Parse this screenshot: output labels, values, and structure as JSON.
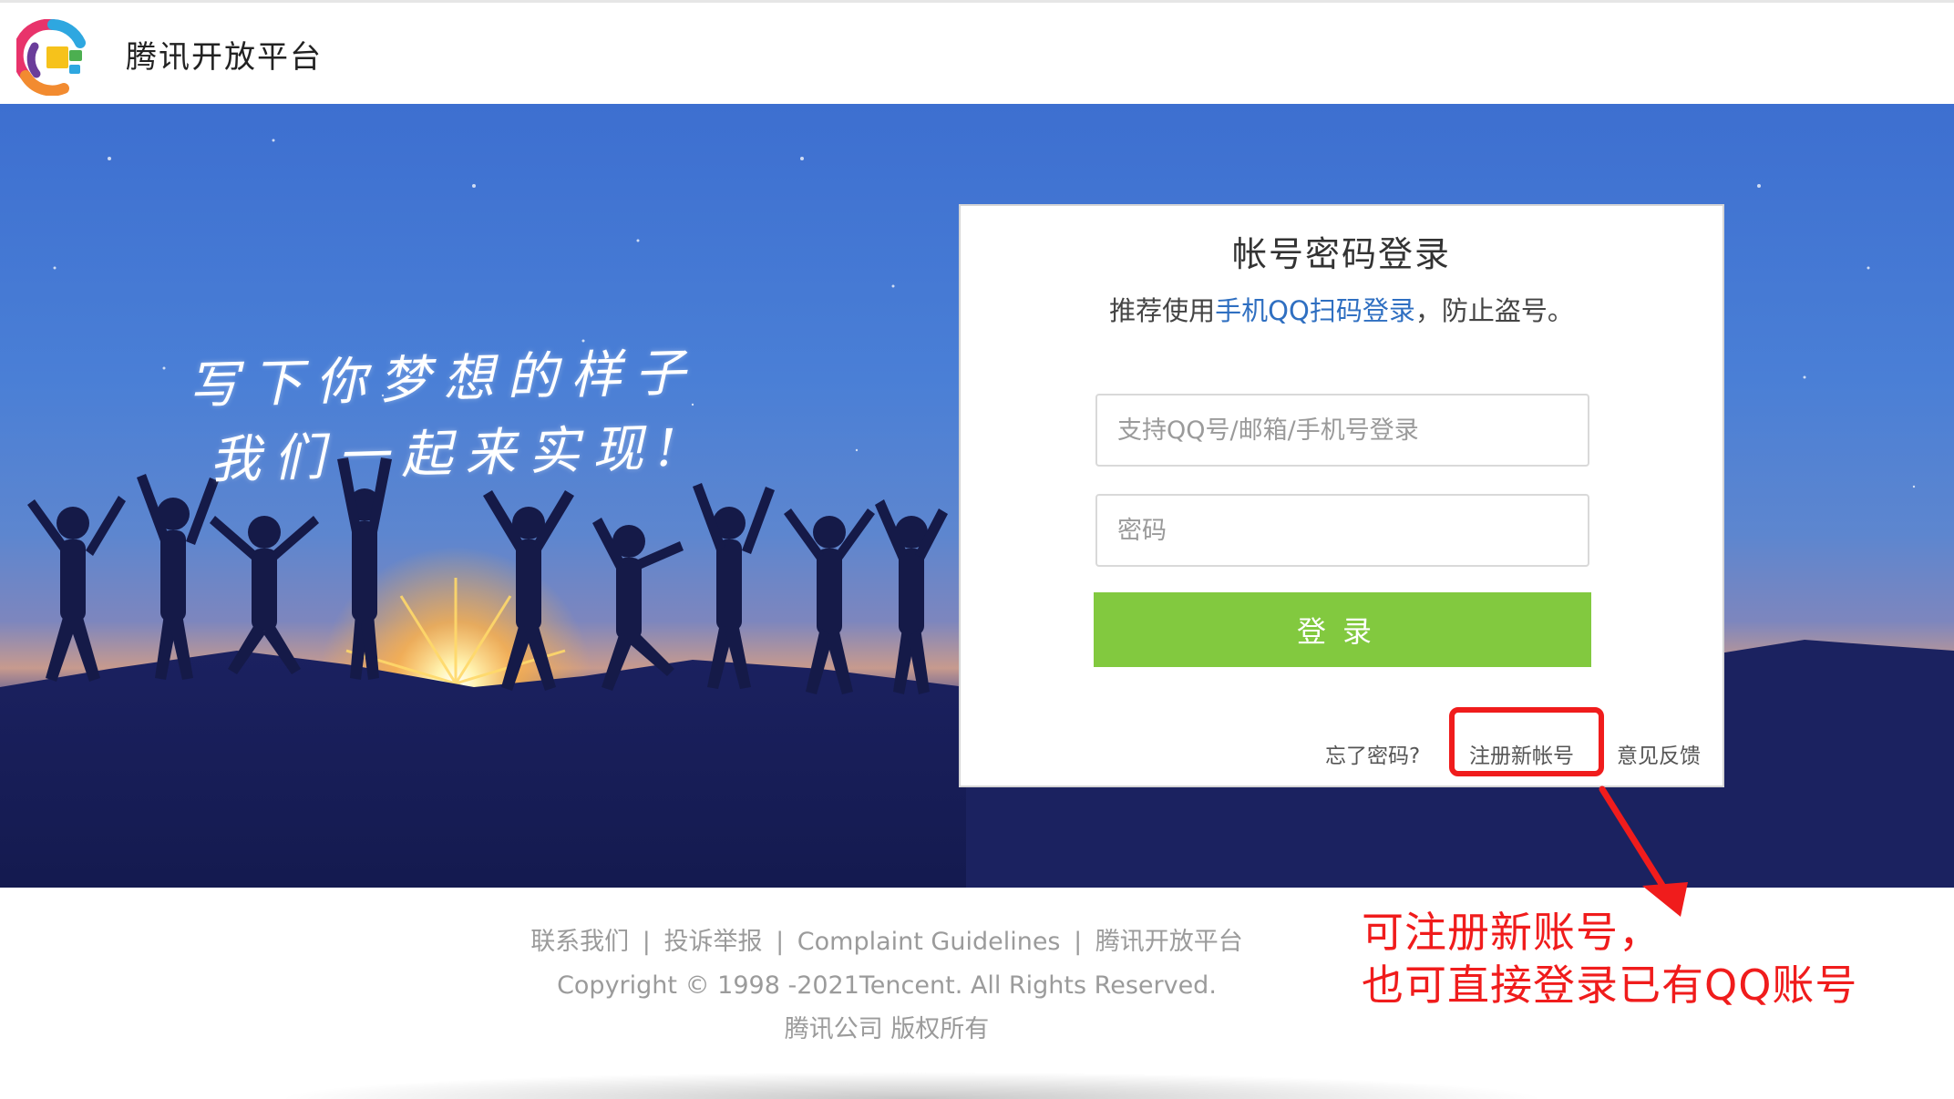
{
  "header": {
    "brand": "腾讯开放平台",
    "logo_icon": "tencent-open-platform-logo"
  },
  "hero": {
    "slogan_line1": "写下你梦想的样子",
    "slogan_line2": "我们一起来实现!"
  },
  "login_card": {
    "title": "帐号密码登录",
    "hint_prefix": "推荐使用",
    "hint_link": "手机QQ扫码登录",
    "hint_suffix": "，防止盗号。",
    "account_placeholder": "支持QQ号/邮箱/手机号登录",
    "account_value": "",
    "password_placeholder": "密码",
    "password_value": "",
    "login_label": "登录",
    "forgot_label": "忘了密码?",
    "register_label": "注册新帐号",
    "feedback_label": "意见反馈",
    "colors": {
      "button": "#82c93f",
      "link": "#2f6fc1"
    }
  },
  "annotation": {
    "line1": "可注册新账号，",
    "line2": "也可直接登录已有QQ账号",
    "color": "#f01c1c"
  },
  "footer": {
    "links": [
      "联系我们",
      "投诉举报",
      "Complaint Guidelines",
      "腾讯开放平台"
    ],
    "separator": "|",
    "copyright": "Copyright © 1998 -2021Tencent. All Rights Reserved.",
    "company": "腾讯公司 版权所有"
  }
}
